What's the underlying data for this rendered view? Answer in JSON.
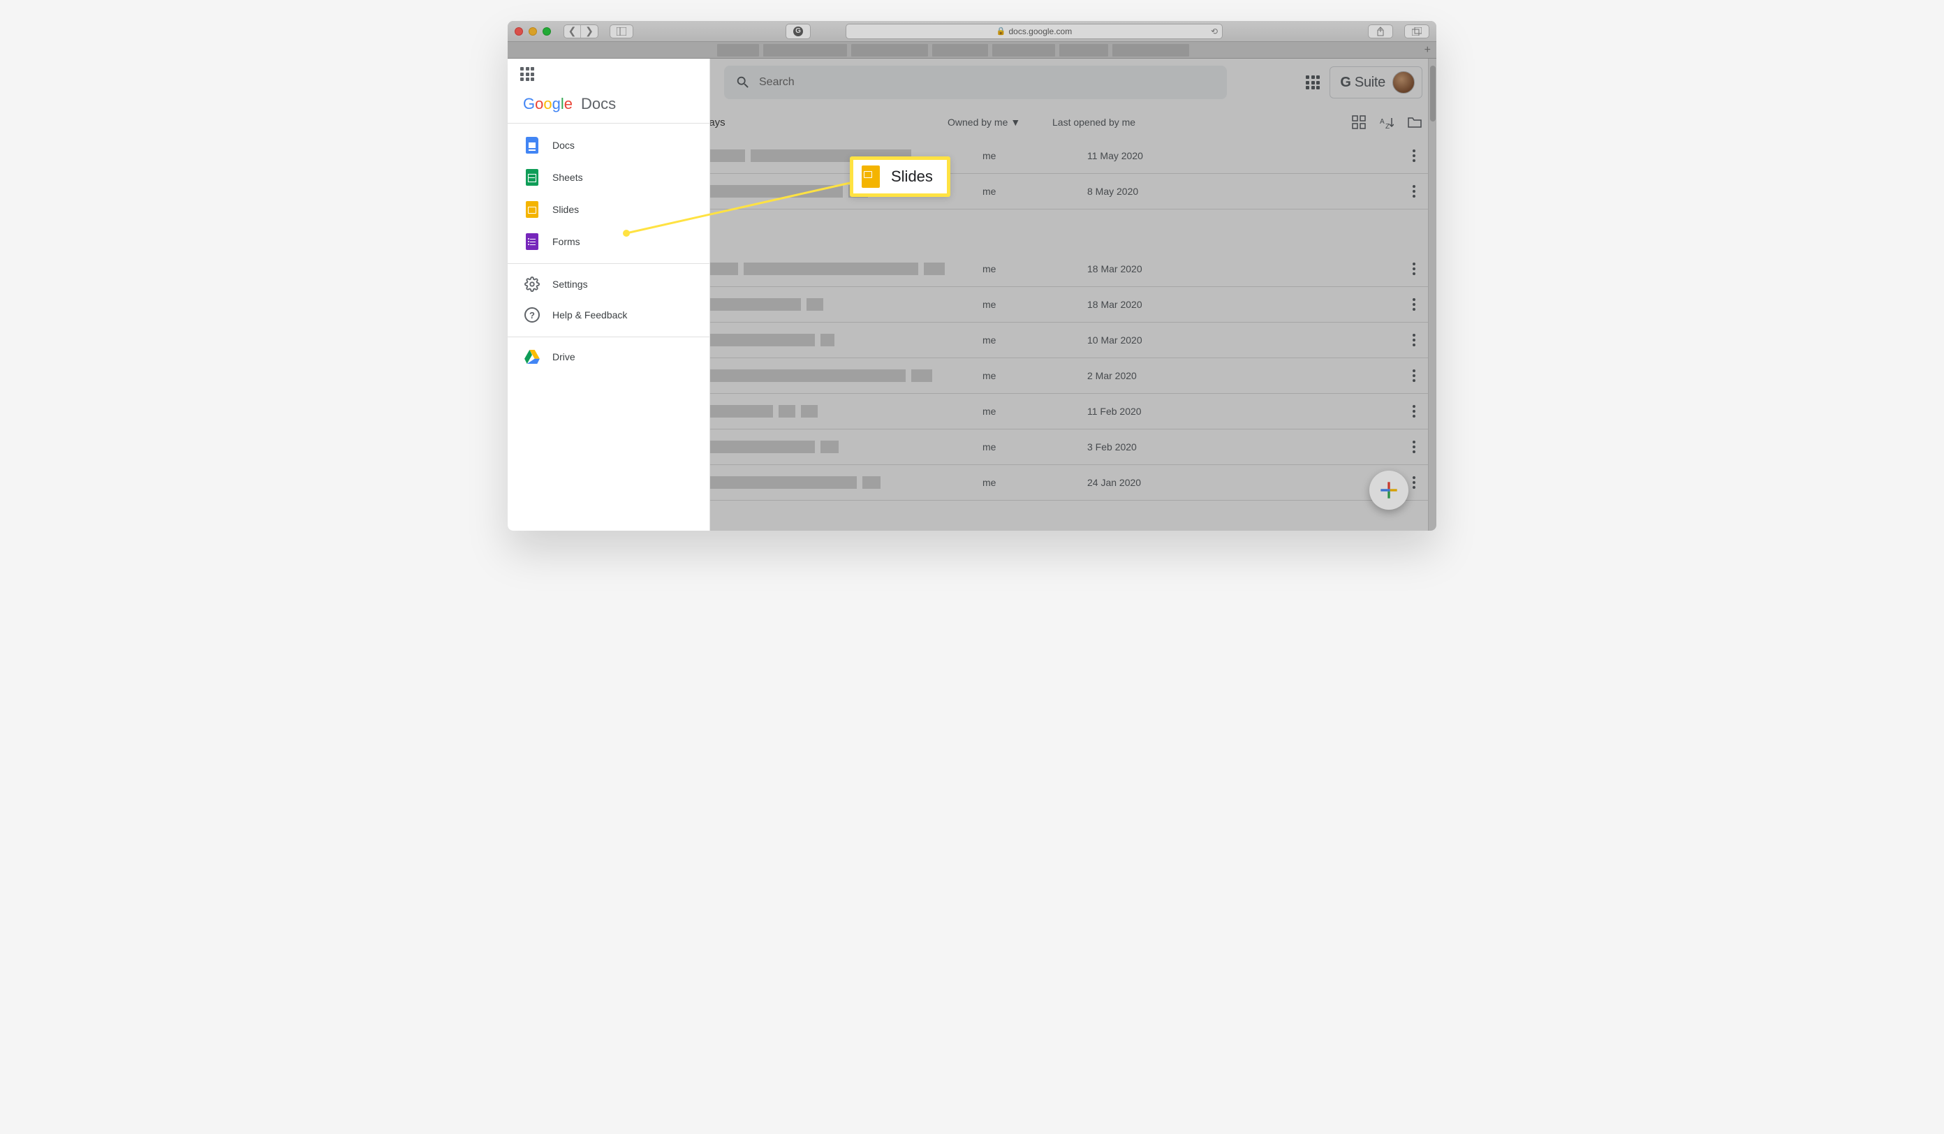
{
  "browser": {
    "url": "docs.google.com"
  },
  "brand": {
    "google": "Google",
    "product": "Docs"
  },
  "sidebar": {
    "docs": "Docs",
    "sheets": "Sheets",
    "slides": "Slides",
    "forms": "Forms",
    "settings": "Settings",
    "help": "Help & Feedback",
    "drive": "Drive"
  },
  "search": {
    "placeholder": "Search"
  },
  "gsuite": {
    "text": "G Suite"
  },
  "listheader": {
    "section": "days",
    "owned": "Owned by me",
    "opened": "Last opened by me"
  },
  "callout": {
    "label": "Slides"
  },
  "rows": [
    {
      "owner": "me",
      "date": "11 May 2020"
    },
    {
      "owner": "me",
      "date": "8 May 2020"
    },
    {
      "owner": "me",
      "date": "18 Mar 2020"
    },
    {
      "owner": "me",
      "date": "18 Mar 2020"
    },
    {
      "owner": "me",
      "date": "10 Mar 2020"
    },
    {
      "owner": "me",
      "date": "2 Mar 2020"
    },
    {
      "owner": "me",
      "date": "11 Feb 2020"
    },
    {
      "owner": "me",
      "date": "3 Feb 2020"
    },
    {
      "owner": "me",
      "date": "24 Jan 2020"
    }
  ]
}
